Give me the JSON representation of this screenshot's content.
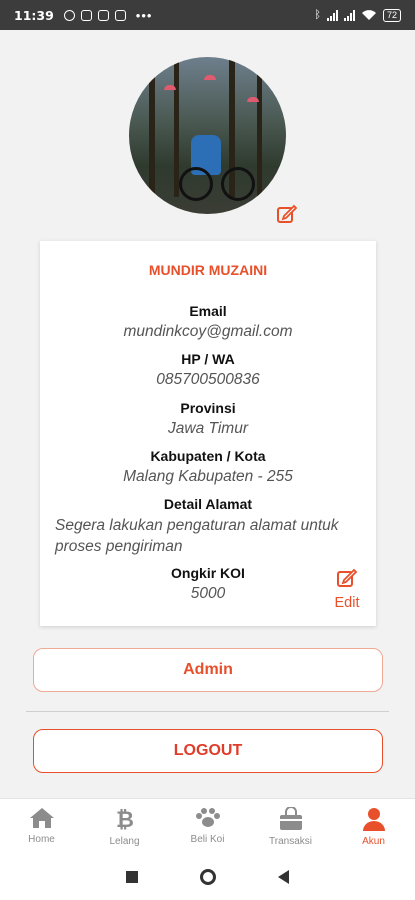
{
  "status_bar": {
    "time": "11:39",
    "dots": "•••",
    "battery": "72"
  },
  "profile": {
    "name": "MUNDIR MUZAINI",
    "email_label": "Email",
    "email": "mundinkcoy@gmail.com",
    "phone_label": "HP / WA",
    "phone": "085700500836",
    "province_label": "Provinsi",
    "province": "Jawa Timur",
    "city_label": "Kabupaten / Kota",
    "city": "Malang Kabupaten - 255",
    "address_label": "Detail Alamat",
    "address": "Segera lakukan pengaturan alamat untuk proses pengiriman",
    "shipping_label": "Ongkir KOI",
    "shipping": "5000",
    "edit_label": "Edit"
  },
  "buttons": {
    "admin": "Admin",
    "logout": "LOGOUT"
  },
  "bottom_nav": {
    "items": [
      {
        "label": "Home",
        "icon": "home-icon"
      },
      {
        "label": "Lelang",
        "icon": "bitcoin-icon"
      },
      {
        "label": "Beli Koi",
        "icon": "paw-icon"
      },
      {
        "label": "Transaksi",
        "icon": "shopping-bag-icon"
      },
      {
        "label": "Akun",
        "icon": "user-icon"
      }
    ],
    "active": "Akun"
  },
  "colors": {
    "accent": "#e8502b",
    "inactive": "#8c8c8c"
  }
}
